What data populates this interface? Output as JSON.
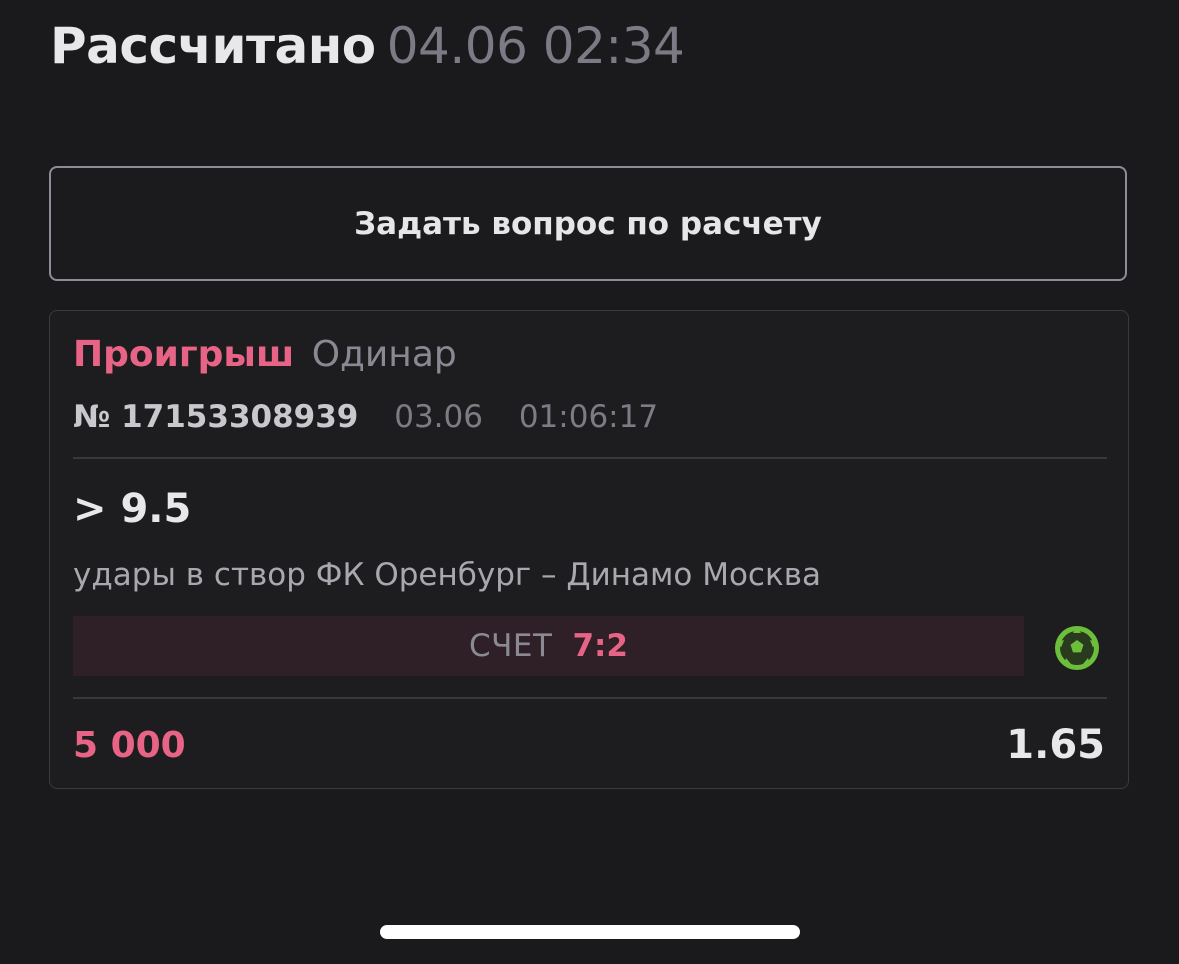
{
  "header": {
    "status": "Рассчитано",
    "datetime": "04.06 02:34"
  },
  "ask_button": {
    "label": "Задать вопрос по расчету"
  },
  "bet": {
    "result": "Проигрыш",
    "type": "Одинар",
    "number": "№ 17153308939",
    "date": "03.06",
    "time": "01:06:17",
    "outcome": "> 9.5",
    "event": "удары в створ ФК Оренбург – Динамо Москва",
    "score_label": "СЧЕТ",
    "score_value": "7:2",
    "sport_icon": "soccer-ball-icon",
    "stake": "5 000",
    "odds": "1.65"
  },
  "colors": {
    "background": "#1a191b",
    "loss": "#e86486",
    "muted": "#7c7b85",
    "score_bar": "#2f1f27",
    "sport_icon": "#6cbf3a"
  }
}
